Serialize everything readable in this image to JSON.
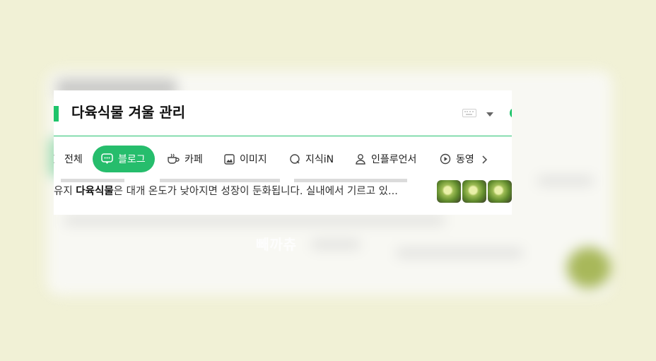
{
  "search": {
    "query": "다육식물 겨울 관리"
  },
  "tabs": [
    {
      "label": "전체",
      "icon": "search-icon"
    },
    {
      "label": "블로그",
      "icon": "blog-icon",
      "active": true
    },
    {
      "label": "카페",
      "icon": "cafe-icon"
    },
    {
      "label": "이미지",
      "icon": "image-icon"
    },
    {
      "label": "지식iN",
      "icon": "knowledge-icon"
    },
    {
      "label": "인플루언서",
      "icon": "person-icon"
    },
    {
      "label": "동영",
      "icon": "play-icon"
    }
  ],
  "result": {
    "prefix": "유지 ",
    "keyword": "다육식물",
    "suffix": "은 대개 온도가 낮아지면 성장이 둔화됩니다. 실내에서 기르고 있..."
  },
  "watermark": "빼까츄",
  "colors": {
    "accent": "#26bd6c",
    "background": "#f1f1d6"
  }
}
